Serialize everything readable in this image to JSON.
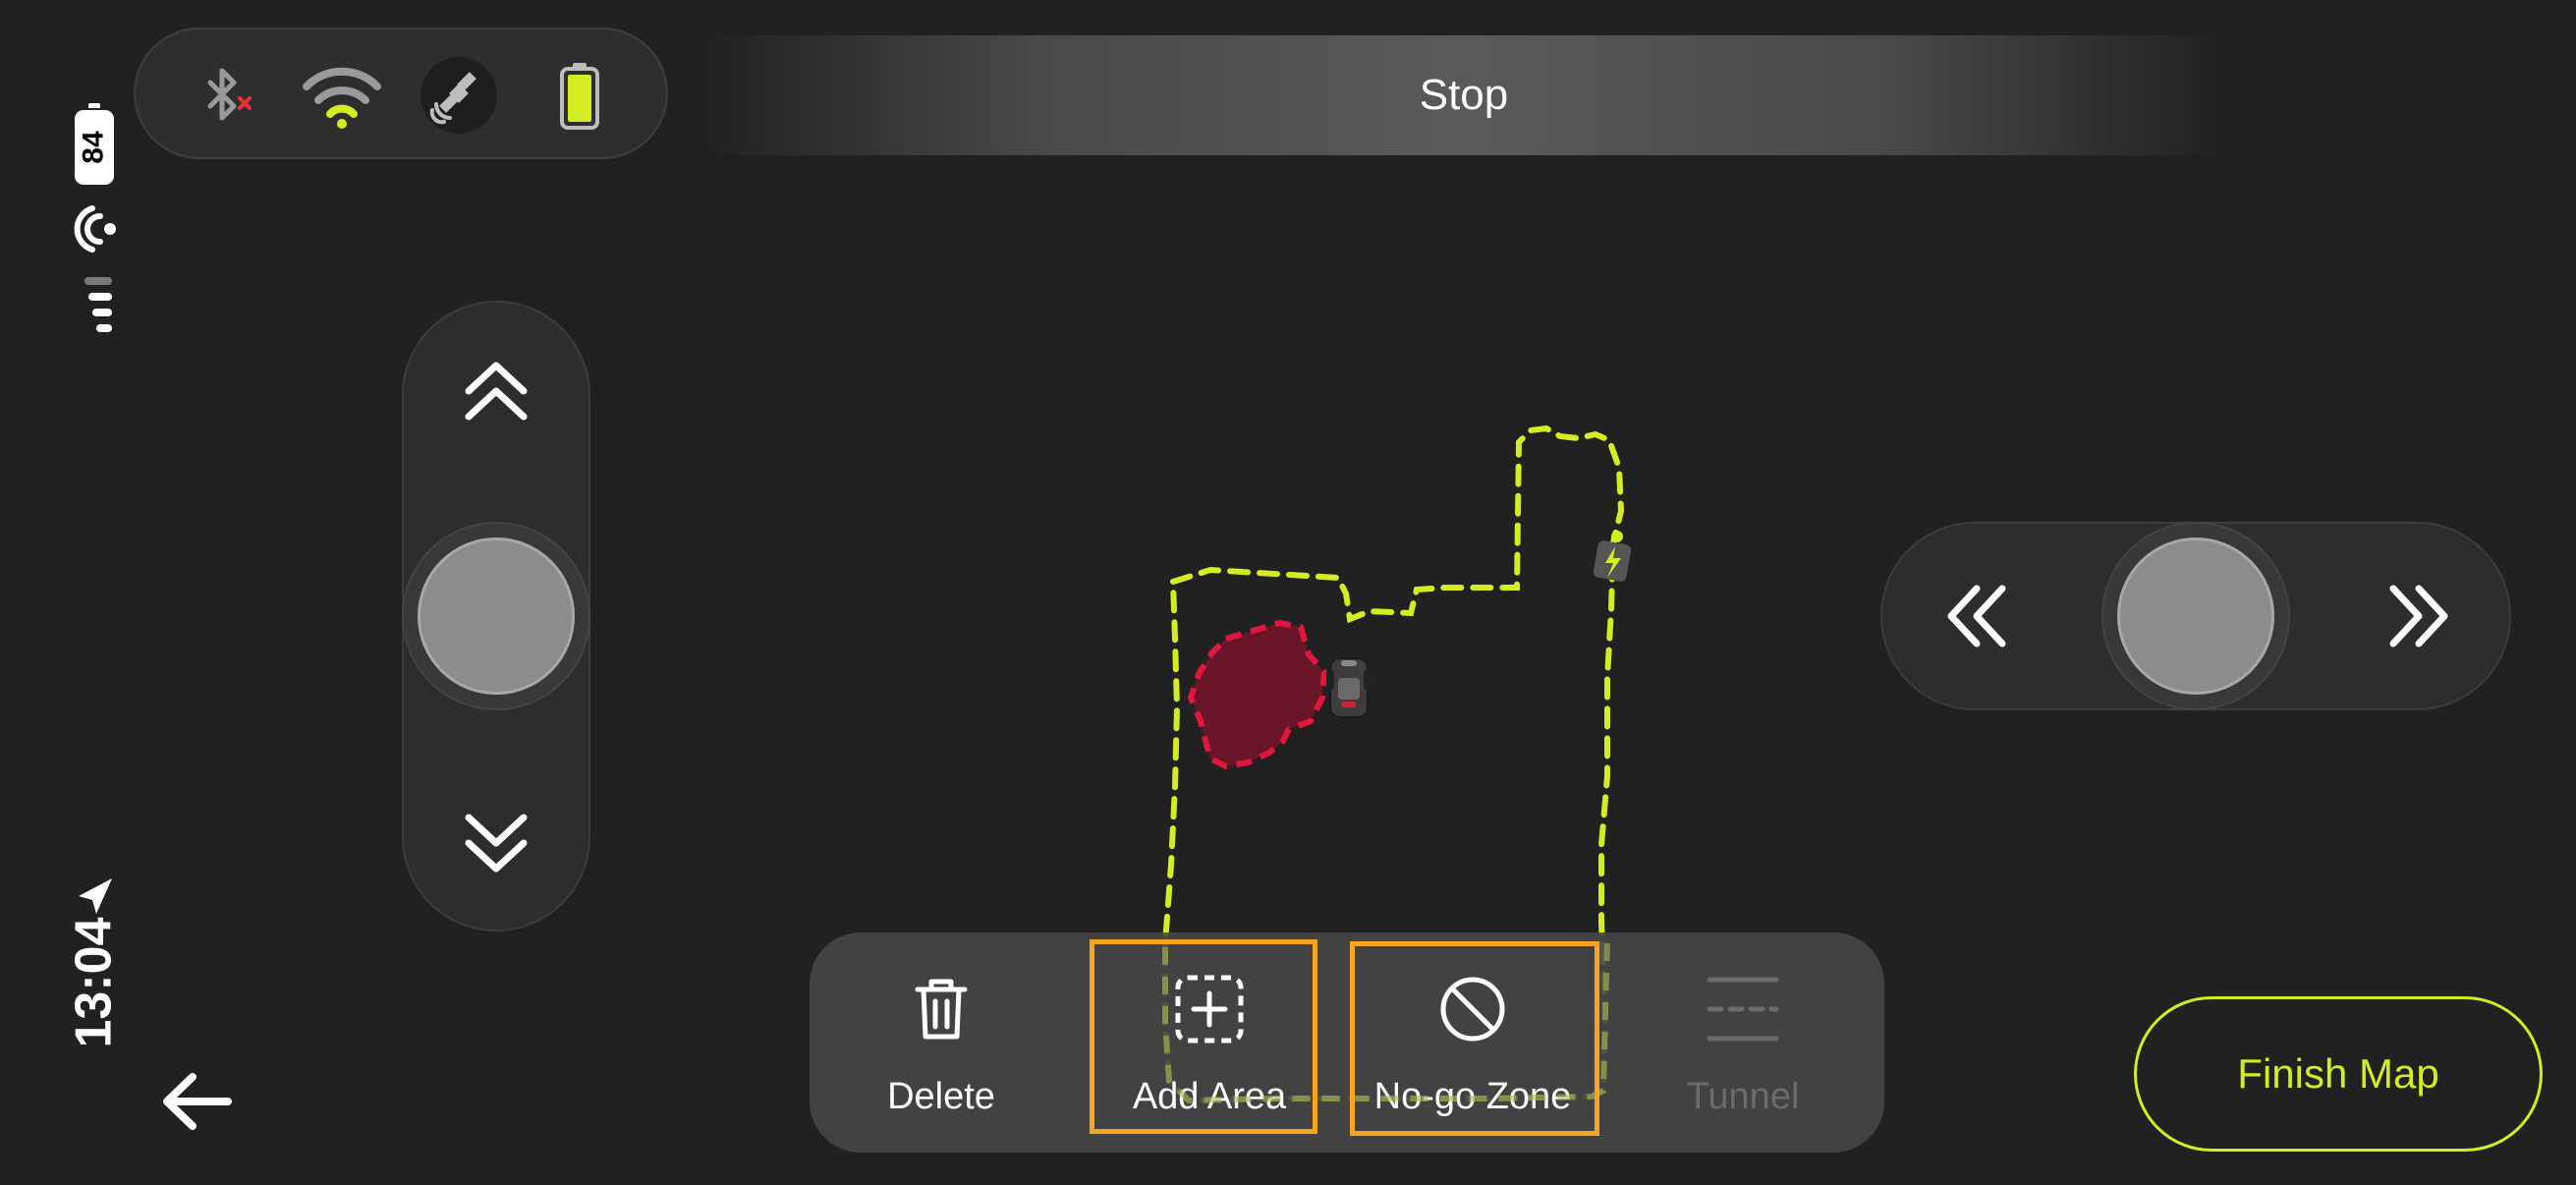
{
  "system": {
    "battery_level": "84",
    "time": "13:04"
  },
  "status_bar": {
    "icons": [
      "bluetooth-disconnected-icon",
      "wifi-icon",
      "satellite-icon",
      "battery-icon"
    ]
  },
  "banner": {
    "text": "Stop"
  },
  "toolbar": {
    "delete_label": "Delete",
    "add_area_label": "Add Area",
    "no_go_label": "No-go Zone",
    "tunnel_label": "Tunnel"
  },
  "actions": {
    "finish_label": "Finish Map"
  },
  "colors": {
    "accent": "#d4ec22",
    "no_go": "#e0173d",
    "highlight": "#f7a521",
    "background": "#212121"
  }
}
